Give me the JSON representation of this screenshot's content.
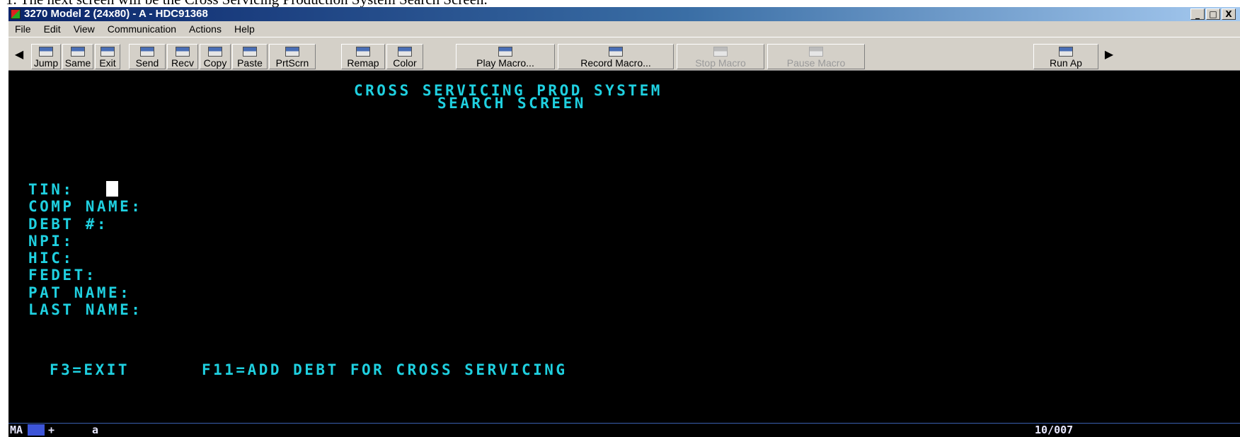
{
  "caption": "1. The next screen will be the Cross Servicing Production System Search Screen.",
  "window": {
    "title": "3270 Model 2 (24x80) - A - HDC91368",
    "buttons": [
      "_",
      "□",
      "X"
    ]
  },
  "menu": [
    "File",
    "Edit",
    "View",
    "Communication",
    "Actions",
    "Help"
  ],
  "toolbar": {
    "buttons": [
      {
        "label": "Jump",
        "icon": "jump-icon",
        "enabled": true
      },
      {
        "label": "Same",
        "icon": "same-icon",
        "enabled": true
      },
      {
        "label": "Exit",
        "icon": "exit-icon",
        "enabled": true
      },
      {
        "label": "Send",
        "icon": "send-icon",
        "enabled": true
      },
      {
        "label": "Recv",
        "icon": "receive-icon",
        "enabled": true
      },
      {
        "label": "Copy",
        "icon": "copy-icon",
        "enabled": true
      },
      {
        "label": "Paste",
        "icon": "paste-icon",
        "enabled": true
      },
      {
        "label": "PrtScrn",
        "icon": "print-screen-icon",
        "enabled": true
      },
      {
        "label": "Remap",
        "icon": "remap-icon",
        "enabled": true
      },
      {
        "label": "Color",
        "icon": "color-icon",
        "enabled": true
      },
      {
        "label": "Play Macro...",
        "icon": "play-macro-icon",
        "enabled": true
      },
      {
        "label": "Record Macro...",
        "icon": "record-macro-icon",
        "enabled": true
      },
      {
        "label": "Stop Macro",
        "icon": "stop-macro-icon",
        "enabled": false
      },
      {
        "label": "Pause Macro",
        "icon": "pause-macro-icon",
        "enabled": false
      },
      {
        "label": "Run Ap",
        "icon": "run-app-icon",
        "enabled": true
      }
    ],
    "scroll_left": "◀",
    "scroll_right": "▶"
  },
  "terminal": {
    "header1": "CROSS SERVICING PROD SYSTEM",
    "header2": "SEARCH SCREEN",
    "fields": [
      "TIN:",
      "COMP NAME:",
      "DEBT #:",
      "NPI:",
      "HIC:",
      "FEDET:",
      "PAT NAME:",
      "LAST NAME:"
    ],
    "pf_exit": "F3=EXIT",
    "pf_add": "F11=ADD DEBT FOR CROSS SERVICING",
    "colors": {
      "text": "#1fd0e0",
      "background": "#000000",
      "cursor": "#ffffff"
    }
  },
  "status": {
    "mode": "MA",
    "indicator": "+",
    "session": "a",
    "cursor_position": "10/007"
  }
}
